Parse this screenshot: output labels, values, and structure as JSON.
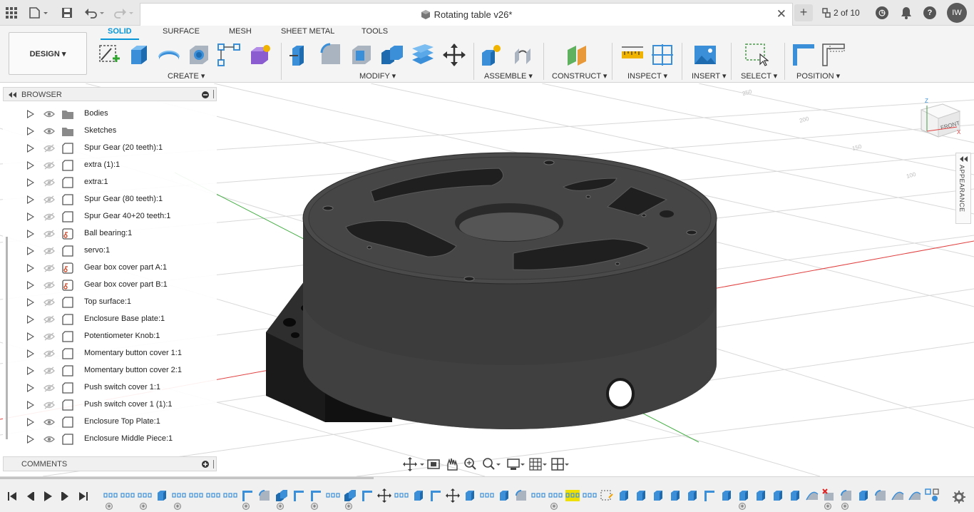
{
  "titlebar": {
    "document_title": "Rotating table v26*",
    "version": "2 of 10",
    "user_initials": "IW",
    "icons": [
      "grid-icon",
      "file-menu-icon",
      "save-icon",
      "undo-icon",
      "redo-icon",
      "document-icon",
      "close-icon",
      "new-tab-icon",
      "version-icon",
      "job-status-icon",
      "notifications-icon",
      "help-icon"
    ]
  },
  "toolbar": {
    "workspace_button": "DESIGN ▾",
    "tabs": [
      "SOLID",
      "SURFACE",
      "MESH",
      "SHEET METAL",
      "TOOLS"
    ],
    "active_tab": "SOLID",
    "groups": {
      "create": "CREATE ▾",
      "modify": "MODIFY ▾",
      "assemble": "ASSEMBLE ▾",
      "construct": "CONSTRUCT ▾",
      "inspect": "INSPECT ▾",
      "insert": "INSERT ▾",
      "select": "SELECT ▾",
      "position": "POSITION ▾"
    }
  },
  "browser": {
    "title": "BROWSER",
    "items": [
      {
        "label": "Bodies",
        "type": "folder",
        "visible": true
      },
      {
        "label": "Sketches",
        "type": "folder",
        "visible": true
      },
      {
        "label": "Spur Gear (20 teeth):1",
        "type": "component",
        "visible": false
      },
      {
        "label": "extra (1):1",
        "type": "component",
        "visible": false
      },
      {
        "label": "extra:1",
        "type": "component",
        "visible": false
      },
      {
        "label": "Spur Gear (80 teeth):1",
        "type": "component",
        "visible": false
      },
      {
        "label": "Spur Gear 40+20 teeth:1",
        "type": "component",
        "visible": false
      },
      {
        "label": "Ball bearing:1",
        "type": "linked-component",
        "visible": false
      },
      {
        "label": "servo:1",
        "type": "component",
        "visible": false
      },
      {
        "label": "Gear box cover part A:1",
        "type": "linked-component",
        "visible": false
      },
      {
        "label": "Gear box cover part B:1",
        "type": "linked-component",
        "visible": false
      },
      {
        "label": "Top surface:1",
        "type": "component",
        "visible": false
      },
      {
        "label": "Enclosure Base plate:1",
        "type": "component",
        "visible": false
      },
      {
        "label": "Potentiometer Knob:1",
        "type": "component",
        "visible": false
      },
      {
        "label": "Momentary button cover 1:1",
        "type": "component",
        "visible": false
      },
      {
        "label": "Momentary button cover 2:1",
        "type": "component",
        "visible": false
      },
      {
        "label": "Push switch cover 1:1",
        "type": "component",
        "visible": false
      },
      {
        "label": "Push switch cover 1 (1):1",
        "type": "component",
        "visible": false
      },
      {
        "label": "Enclosure Top Plate:1",
        "type": "component",
        "visible": true
      },
      {
        "label": "Enclosure Middle Piece:1",
        "type": "component",
        "visible": true
      }
    ]
  },
  "comments": {
    "title": "COMMENTS"
  },
  "appearance": {
    "label": "APPEARANCE"
  },
  "viewcube": {
    "face": "FRONT",
    "axis_z": "Z",
    "axis_x": "X"
  },
  "colors": {
    "accent": "#0696d7",
    "model": "#3a3a3a",
    "axis_red": "#e04040",
    "axis_green": "#4ab04a",
    "highlight": "#f0e000"
  }
}
